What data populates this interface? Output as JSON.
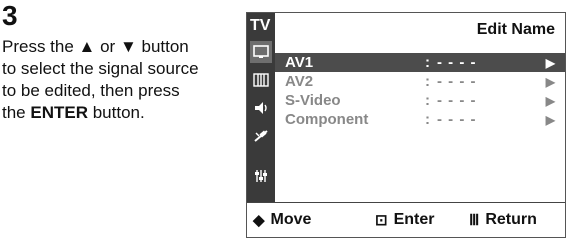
{
  "step": {
    "number": "3"
  },
  "instructions": {
    "line1a": "Press the ",
    "up_glyph": "▲",
    "line1b": " or ",
    "down_glyph": "▼",
    "line1c": " button",
    "line2": "to select the signal source",
    "line3": "to be edited, then press",
    "line4a": "the ",
    "enter_bold": "ENTER",
    "line4b": " button."
  },
  "osd": {
    "tv_label": "TV",
    "title": "Edit Name",
    "sidebar_icons": [
      "picture-icon",
      "sound-icon",
      "channel-icon",
      "setup-icon",
      "input-icon"
    ],
    "items": [
      {
        "label": "AV1",
        "colon": ":",
        "value": "- - - -",
        "arrow": "▶"
      },
      {
        "label": "AV2",
        "colon": ":",
        "value": "- - - -",
        "arrow": "▶"
      },
      {
        "label": "S-Video",
        "colon": ":",
        "value": "- - - -",
        "arrow": "▶"
      },
      {
        "label": "Component",
        "colon": ":",
        "value": "- - - -",
        "arrow": "▶"
      }
    ],
    "footer": {
      "move_icon": "◆",
      "move_label": "Move",
      "enter_icon": "⊡",
      "enter_label": "Enter",
      "return_icon": "Ⅲ",
      "return_label": "Return"
    }
  }
}
